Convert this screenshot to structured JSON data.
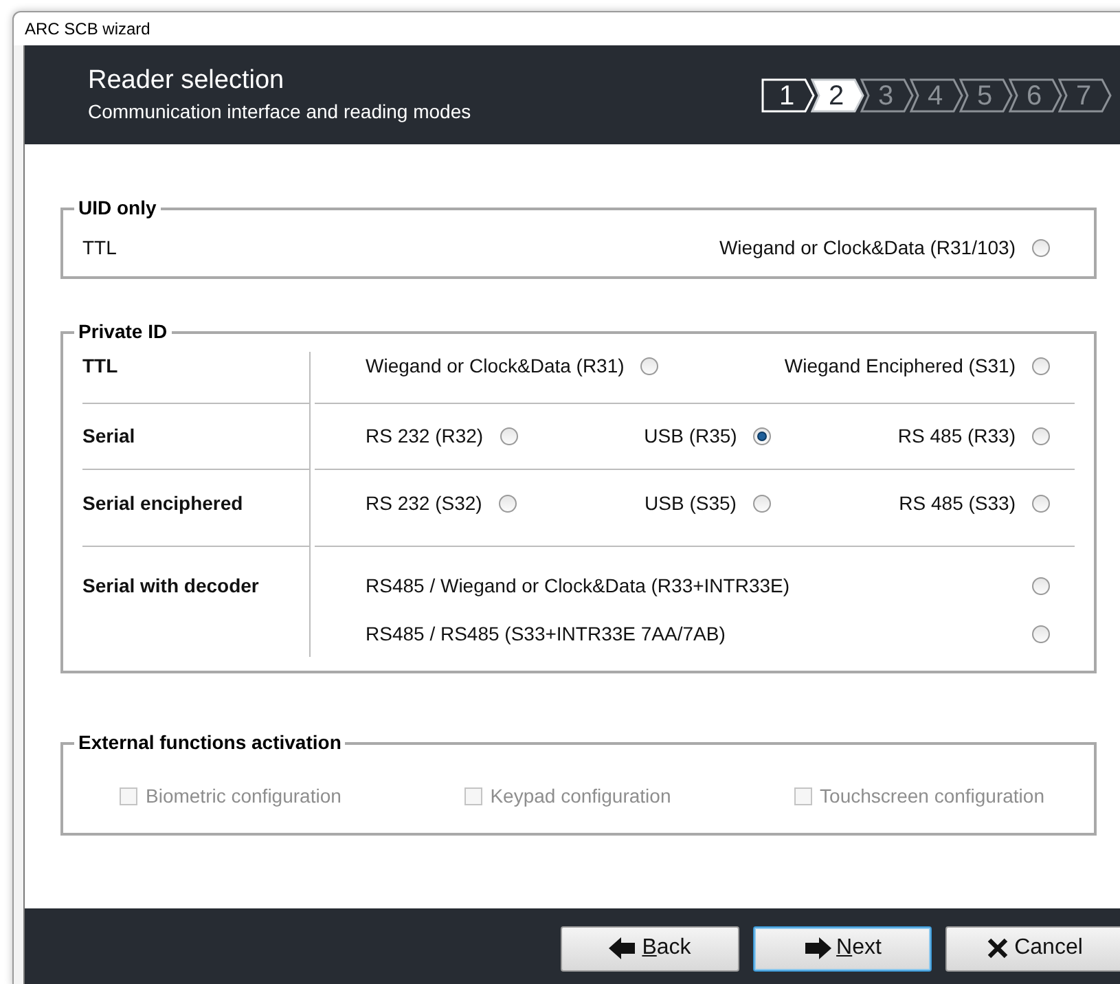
{
  "window": {
    "title": "ARC SCB wizard"
  },
  "header": {
    "title": "Reader selection",
    "subtitle": "Communication interface and reading modes"
  },
  "steps": [
    {
      "label": "1",
      "completed": true,
      "selected": false
    },
    {
      "label": "2",
      "completed": false,
      "selected": true
    },
    {
      "label": "3",
      "completed": false,
      "selected": false
    },
    {
      "label": "4",
      "completed": false,
      "selected": false
    },
    {
      "label": "5",
      "completed": false,
      "selected": false
    },
    {
      "label": "6",
      "completed": false,
      "selected": false
    },
    {
      "label": "7",
      "completed": false,
      "selected": false
    }
  ],
  "uid_only": {
    "title": "UID only",
    "label": "TTL",
    "options": [
      {
        "label": "Wiegand or Clock&Data (R31/103)",
        "selected": false
      }
    ]
  },
  "private_id": {
    "title": "Private ID",
    "rows": [
      {
        "label": "TTL",
        "kind": "inline",
        "options": [
          {
            "label": "Wiegand or Clock&Data (R31)",
            "selected": false
          },
          {
            "label": "Wiegand Enciphered (S31)",
            "selected": false
          }
        ]
      },
      {
        "label": "Serial",
        "kind": "inline",
        "options": [
          {
            "label": "RS 232 (R32)",
            "selected": false
          },
          {
            "label": "USB (R35)",
            "selected": true
          },
          {
            "label": "RS 485 (R33)",
            "selected": false
          }
        ]
      },
      {
        "label": "Serial enciphered",
        "kind": "inline",
        "options": [
          {
            "label": "RS 232 (S32)",
            "selected": false
          },
          {
            "label": "USB (S35)",
            "selected": false
          },
          {
            "label": "RS 485 (S33)",
            "selected": false
          }
        ]
      },
      {
        "label": "Serial with decoder",
        "kind": "stacked",
        "options": [
          {
            "label": "RS485 / Wiegand or Clock&Data (R33+INTR33E)",
            "selected": false
          },
          {
            "label": "RS485 / RS485 (S33+INTR33E 7AA/7AB)",
            "selected": false
          }
        ]
      }
    ]
  },
  "external_functions": {
    "title": "External functions activation",
    "items": [
      {
        "label": "Biometric configuration",
        "checked": false,
        "disabled": true
      },
      {
        "label": "Keypad configuration",
        "checked": false,
        "disabled": true
      },
      {
        "label": "Touchscreen configuration",
        "checked": false,
        "disabled": true
      }
    ]
  },
  "buttons": [
    {
      "label": "Back",
      "kind": "back",
      "underlined_key": true,
      "focused": false
    },
    {
      "label": "Next",
      "kind": "next",
      "underlined_key": true,
      "focused": true
    },
    {
      "label": "Cancel",
      "kind": "cancel",
      "underlined_key": false,
      "focused": false
    }
  ]
}
